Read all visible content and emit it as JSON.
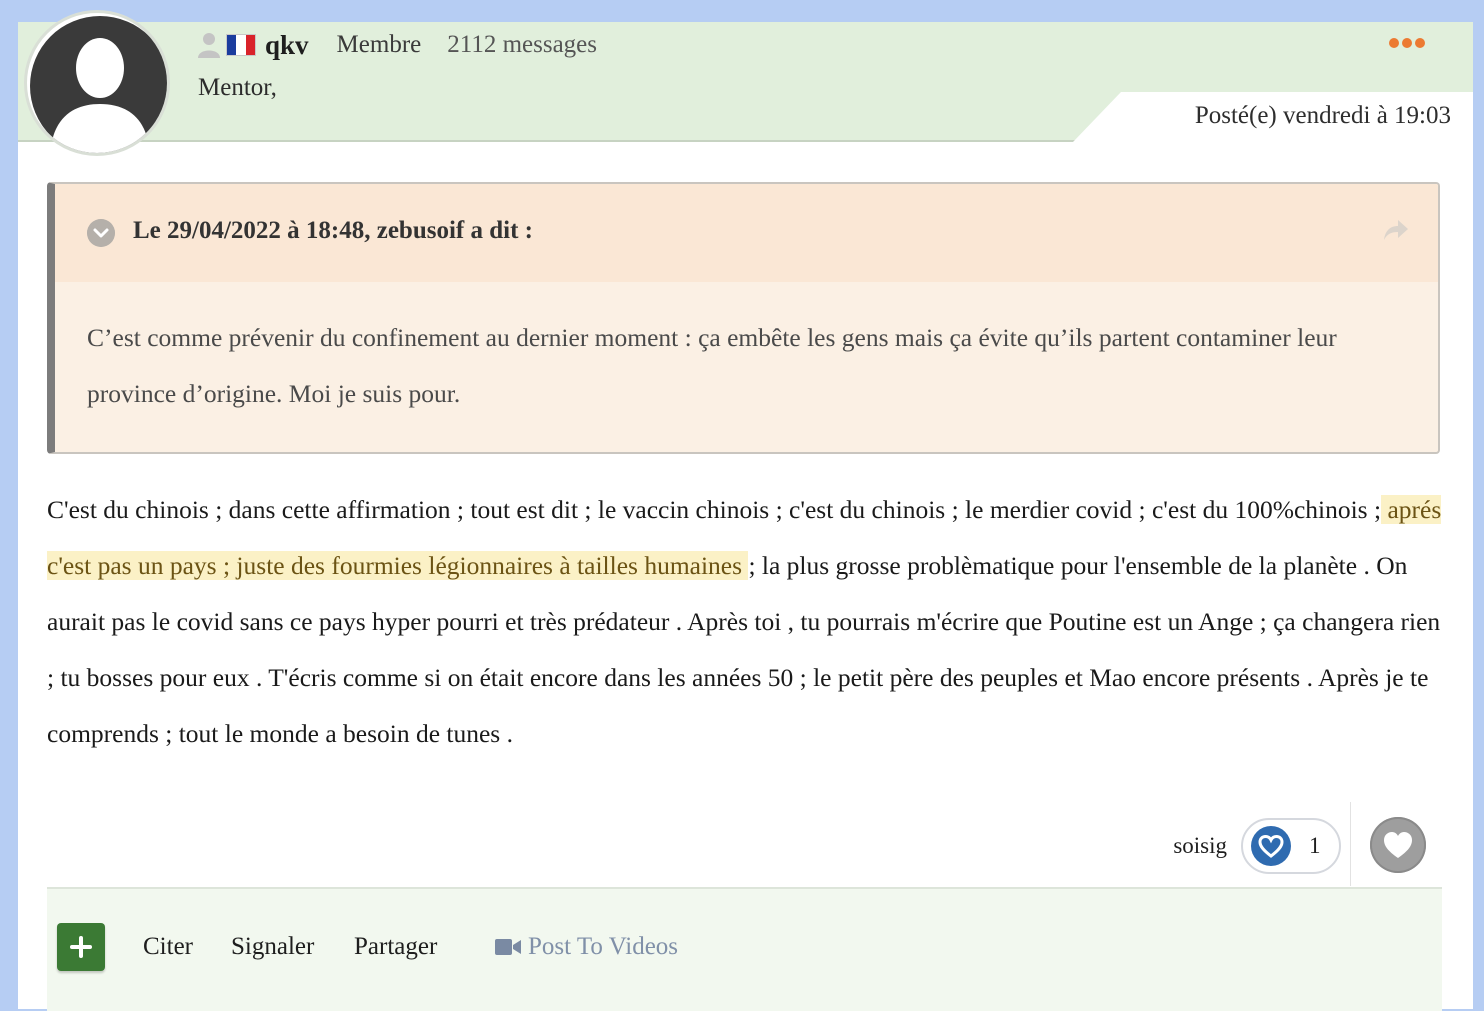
{
  "post": {
    "author": {
      "username": "qkv",
      "role": "Membre",
      "message_count": "2112 messages",
      "subtitle": "Mentor,",
      "flag_colors": [
        "#1a3c9e",
        "#ffffff",
        "#d9222a"
      ]
    },
    "posted_at": "Posté(e) vendredi à 19:03",
    "more_icon": "ellipsis-icon",
    "quote": {
      "title": "Le 29/04/2022 à 18:48, zebusoif a dit :",
      "text": "C’est comme prévenir du confinement au dernier moment : ça embête les gens mais ça évite qu’ils partent contaminer leur province d’origine. Moi je suis pour."
    },
    "body": {
      "before_highlight": "C'est du chinois ; dans cette affirmation ; tout est dit ; le vaccin chinois ; c'est du chinois ; le merdier covid ; c'est du 100%chinois ;",
      "highlight": " aprés c'est pas un pays ; juste des fourmies légionnaires à tailles humaines ",
      "after_highlight": "; la plus grosse problèmatique pour l'ensemble de la planète . On aurait pas le covid sans ce pays hyper pourri et très prédateur .  Après toi , tu pourrais m'écrire que Poutine est un Ange ; ça changera rien ; tu bosses pour eux . T'écris comme si on était encore dans les années 50 ; le petit père des peuples et Mao encore présents . Après je te comprends ; tout le monde a besoin de tunes ."
    },
    "reactions": {
      "reactor": "soisig",
      "count": "1",
      "icon": "heart-icon"
    },
    "actions": {
      "quote": "Citer",
      "report": "Signaler",
      "share": "Partager",
      "post_to_videos": "Post To Videos"
    }
  },
  "colors": {
    "page_bg": "#b6cdf3",
    "header_bg": "#e1efdc",
    "accent_orange": "#ec7a32",
    "highlight_bg": "#fbf1c6",
    "add_button": "#3b7a34",
    "heart_blue": "#2f6bb0"
  }
}
